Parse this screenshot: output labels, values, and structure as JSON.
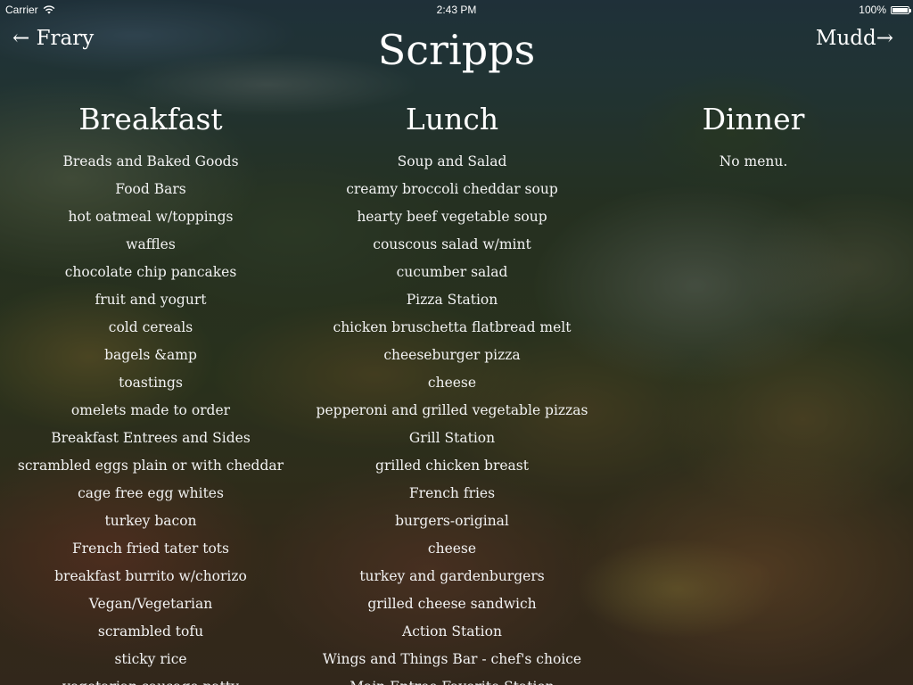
{
  "status_bar": {
    "carrier": "Carrier",
    "time": "2:43 PM",
    "battery": "100%"
  },
  "nav": {
    "back_label": "← Frary",
    "forward_label": "Mudd→",
    "title": "Scripps"
  },
  "meals": {
    "breakfast": {
      "heading": "Breakfast",
      "items": [
        "Breads and Baked Goods",
        "Food Bars",
        "hot oatmeal w/toppings",
        "waffles",
        "chocolate chip pancakes",
        "fruit and yogurt",
        "cold cereals",
        "bagels &amp",
        "toastings",
        "omelets made to order",
        "Breakfast Entrees and Sides",
        "scrambled eggs plain or with cheddar",
        "cage free egg whites",
        "turkey bacon",
        "French fried tater tots",
        "breakfast burrito w/chorizo",
        "Vegan/Vegetarian",
        "scrambled tofu",
        "sticky rice",
        "vegetarian sausage patty"
      ]
    },
    "lunch": {
      "heading": "Lunch",
      "items": [
        "Soup and Salad",
        "creamy broccoli cheddar soup",
        "hearty beef vegetable soup",
        "couscous salad w/mint",
        "cucumber salad",
        "Pizza Station",
        "chicken bruschetta flatbread melt",
        "cheeseburger pizza",
        "cheese",
        "pepperoni and grilled vegetable pizzas",
        "Grill Station",
        "grilled chicken breast",
        "French fries",
        "burgers-original",
        "cheese",
        "turkey and gardenburgers",
        "grilled cheese sandwich",
        "Action Station",
        "Wings and Things Bar - chef's choice",
        "Main Entree Favorite Station"
      ]
    },
    "dinner": {
      "heading": "Dinner",
      "items": [
        "No menu."
      ]
    }
  }
}
